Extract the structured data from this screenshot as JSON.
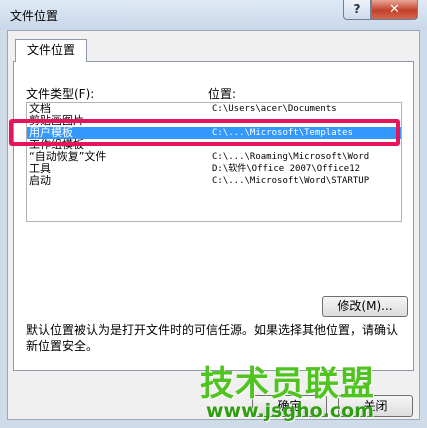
{
  "window": {
    "title": "文件位置",
    "help_glyph": "?",
    "close_glyph": "✕"
  },
  "tab": {
    "label": "文件位置"
  },
  "labels": {
    "file_type": "文件类型(F):",
    "location": "位置:"
  },
  "rows": [
    {
      "type": "文档",
      "location": "C:\\Users\\acer\\Documents"
    },
    {
      "type": "剪贴画图片",
      "location": ""
    },
    {
      "type": "用户模板",
      "location": "C:\\...\\Microsoft\\Templates"
    },
    {
      "type": "工作组模板",
      "location": ""
    },
    {
      "type": "“自动恢复”文件",
      "location": "C:\\...\\Roaming\\Microsoft\\Word"
    },
    {
      "type": "工具",
      "location": "D:\\软件\\Office 2007\\Office12"
    },
    {
      "type": "启动",
      "location": "C:\\...\\Microsoft\\Word\\STARTUP"
    }
  ],
  "selected_index": 2,
  "buttons": {
    "modify": "修改(M)...",
    "ok": "确定",
    "cancel": "关闭"
  },
  "note": "默认位置被认为是打开文件时的可信任源。如果选择其他位置，请确认新位置安全。",
  "watermark": {
    "text": "技术员联盟",
    "url": "www.jsgho.com"
  },
  "colors": {
    "highlight": "#e6145a",
    "selection": "#3399ff",
    "watermark": "#4fc41f"
  }
}
